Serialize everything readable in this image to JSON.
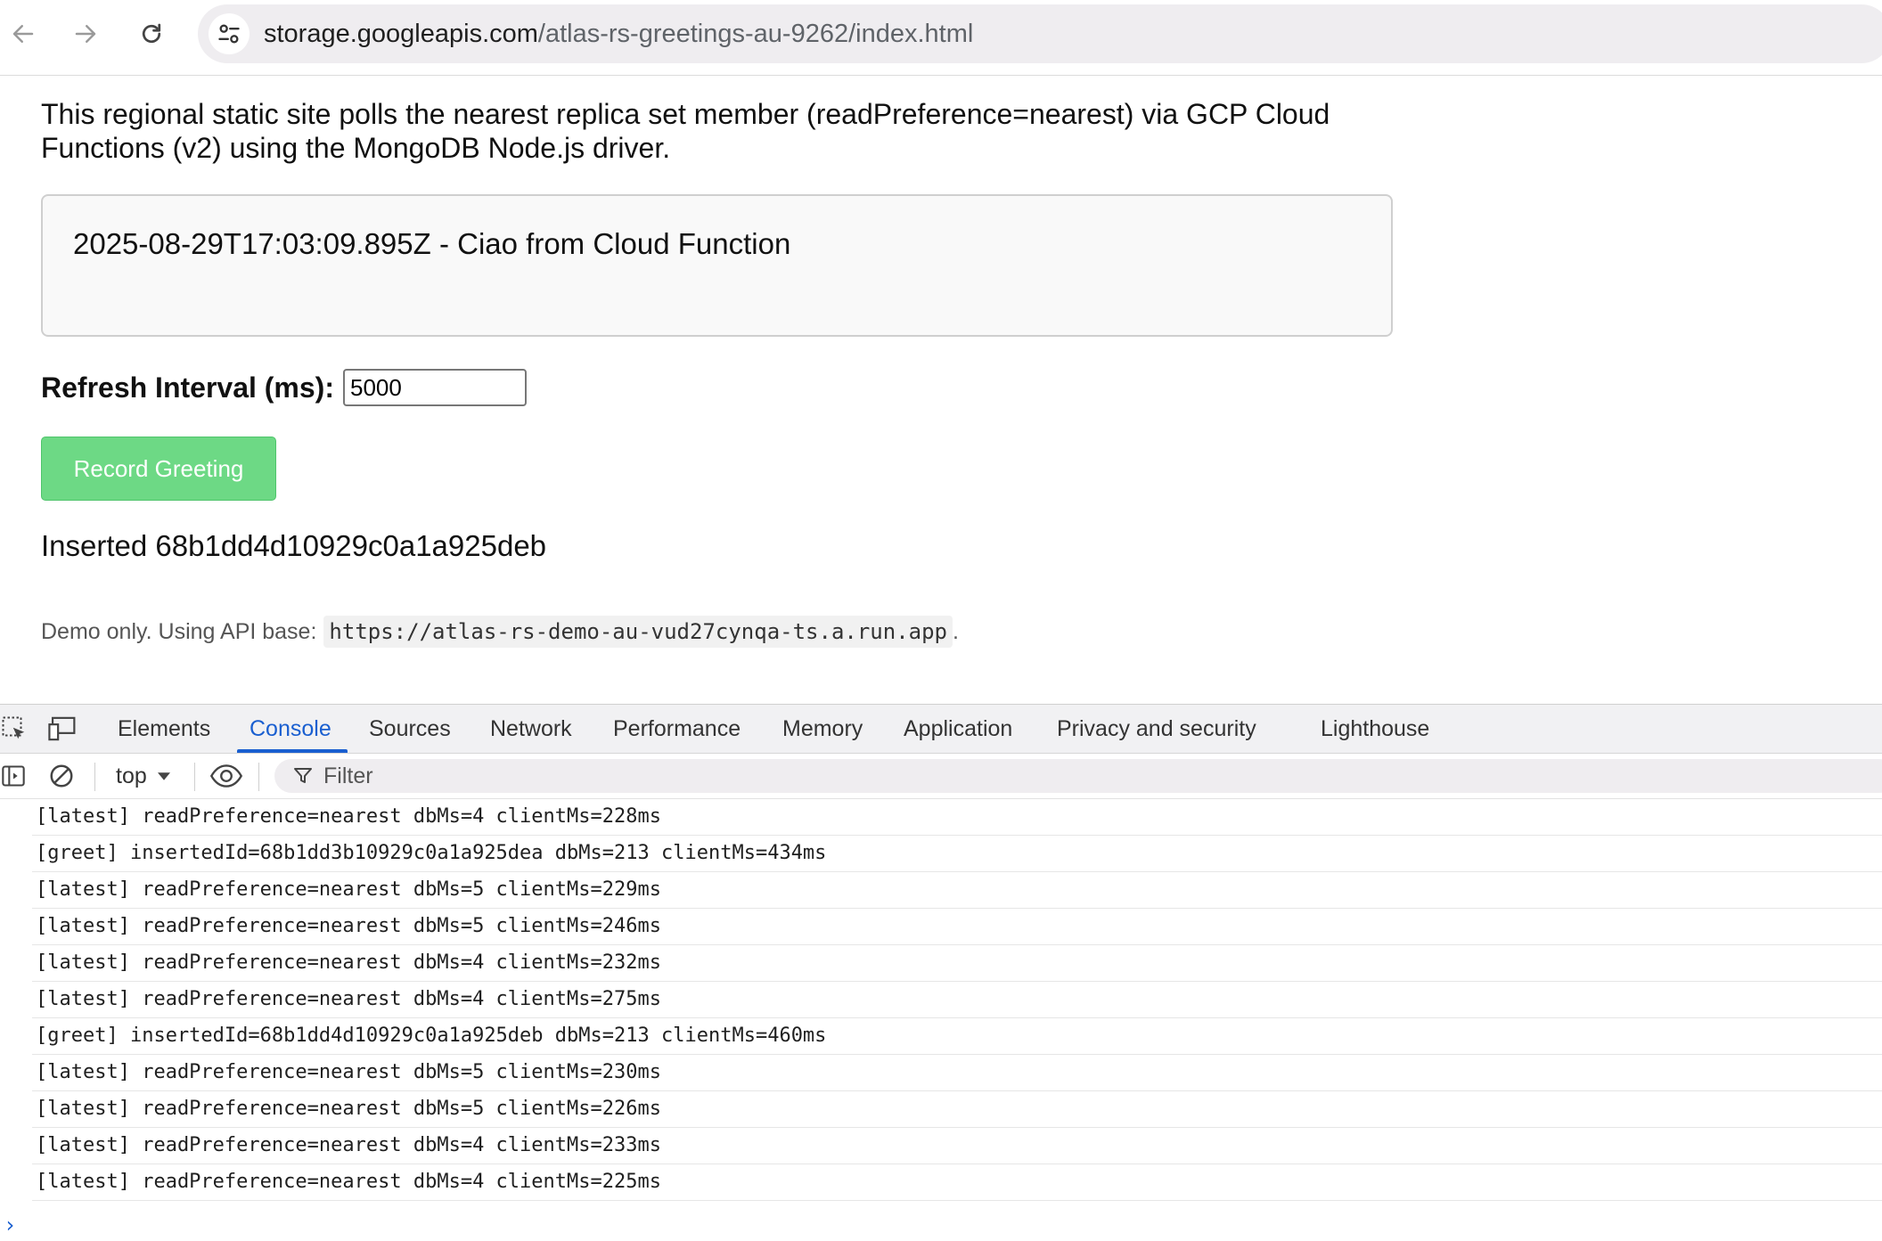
{
  "browser": {
    "url_host": "storage.googleapis.com",
    "url_path": "/atlas-rs-greetings-au-9262/index.html"
  },
  "page": {
    "intro": "This regional static site polls the nearest replica set member (readPreference=nearest) via GCP Cloud Functions (v2) using the MongoDB Node.js driver.",
    "latest_greeting": "2025-08-29T17:03:09.895Z - Ciao from Cloud Function",
    "refresh_label": "Refresh Interval (ms):",
    "refresh_value": "5000",
    "record_button": "Record Greeting",
    "inserted_status": "Inserted 68b1dd4d10929c0a1a925deb",
    "demo_note_prefix": "Demo only. Using API base:",
    "api_base": "https://atlas-rs-demo-au-vud27cynqa-ts.a.run.app",
    "demo_note_suffix": "."
  },
  "devtools": {
    "tabs": [
      {
        "label": "Elements"
      },
      {
        "label": "Console"
      },
      {
        "label": "Sources"
      },
      {
        "label": "Network"
      },
      {
        "label": "Performance"
      },
      {
        "label": "Memory"
      },
      {
        "label": "Application"
      },
      {
        "label": "Privacy and security"
      },
      {
        "label": "Lighthouse"
      }
    ],
    "active_tab": "Console",
    "context": "top",
    "filter_placeholder": "Filter",
    "console_lines": [
      "[latest] readPreference=nearest dbMs=4 clientMs=228ms",
      "[greet] insertedId=68b1dd3b10929c0a1a925dea dbMs=213 clientMs=434ms",
      "[latest] readPreference=nearest dbMs=5 clientMs=229ms",
      "[latest] readPreference=nearest dbMs=5 clientMs=246ms",
      "[latest] readPreference=nearest dbMs=4 clientMs=232ms",
      "[latest] readPreference=nearest dbMs=4 clientMs=275ms",
      "[greet] insertedId=68b1dd4d10929c0a1a925deb dbMs=213 clientMs=460ms",
      "[latest] readPreference=nearest dbMs=5 clientMs=230ms",
      "[latest] readPreference=nearest dbMs=5 clientMs=226ms",
      "[latest] readPreference=nearest dbMs=4 clientMs=233ms",
      "[latest] readPreference=nearest dbMs=4 clientMs=225ms"
    ],
    "prompt_symbol": "›"
  },
  "colors": {
    "accent": "#1a5fd0",
    "button_green": "#6dd985"
  }
}
